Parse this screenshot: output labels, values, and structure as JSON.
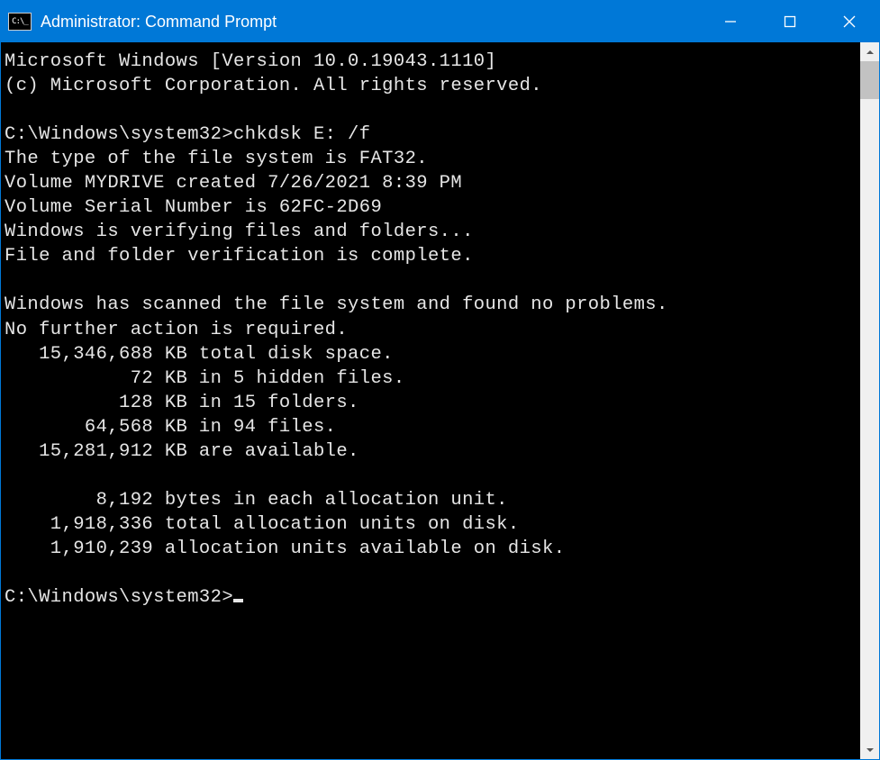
{
  "window": {
    "title": "Administrator: Command Prompt"
  },
  "terminal": {
    "line01": "Microsoft Windows [Version 10.0.19043.1110]",
    "line02": "(c) Microsoft Corporation. All rights reserved.",
    "line03": "",
    "line04": "C:\\Windows\\system32>chkdsk E: /f",
    "line05": "The type of the file system is FAT32.",
    "line06": "Volume MYDRIVE created 7/26/2021 8:39 PM",
    "line07": "Volume Serial Number is 62FC-2D69",
    "line08": "Windows is verifying files and folders...",
    "line09": "File and folder verification is complete.",
    "line10": "",
    "line11": "Windows has scanned the file system and found no problems.",
    "line12": "No further action is required.",
    "line13": "   15,346,688 KB total disk space.",
    "line14": "           72 KB in 5 hidden files.",
    "line15": "          128 KB in 15 folders.",
    "line16": "       64,568 KB in 94 files.",
    "line17": "   15,281,912 KB are available.",
    "line18": "",
    "line19": "        8,192 bytes in each allocation unit.",
    "line20": "    1,918,336 total allocation units on disk.",
    "line21": "    1,910,239 allocation units available on disk.",
    "line22": "",
    "prompt": "C:\\Windows\\system32>"
  }
}
